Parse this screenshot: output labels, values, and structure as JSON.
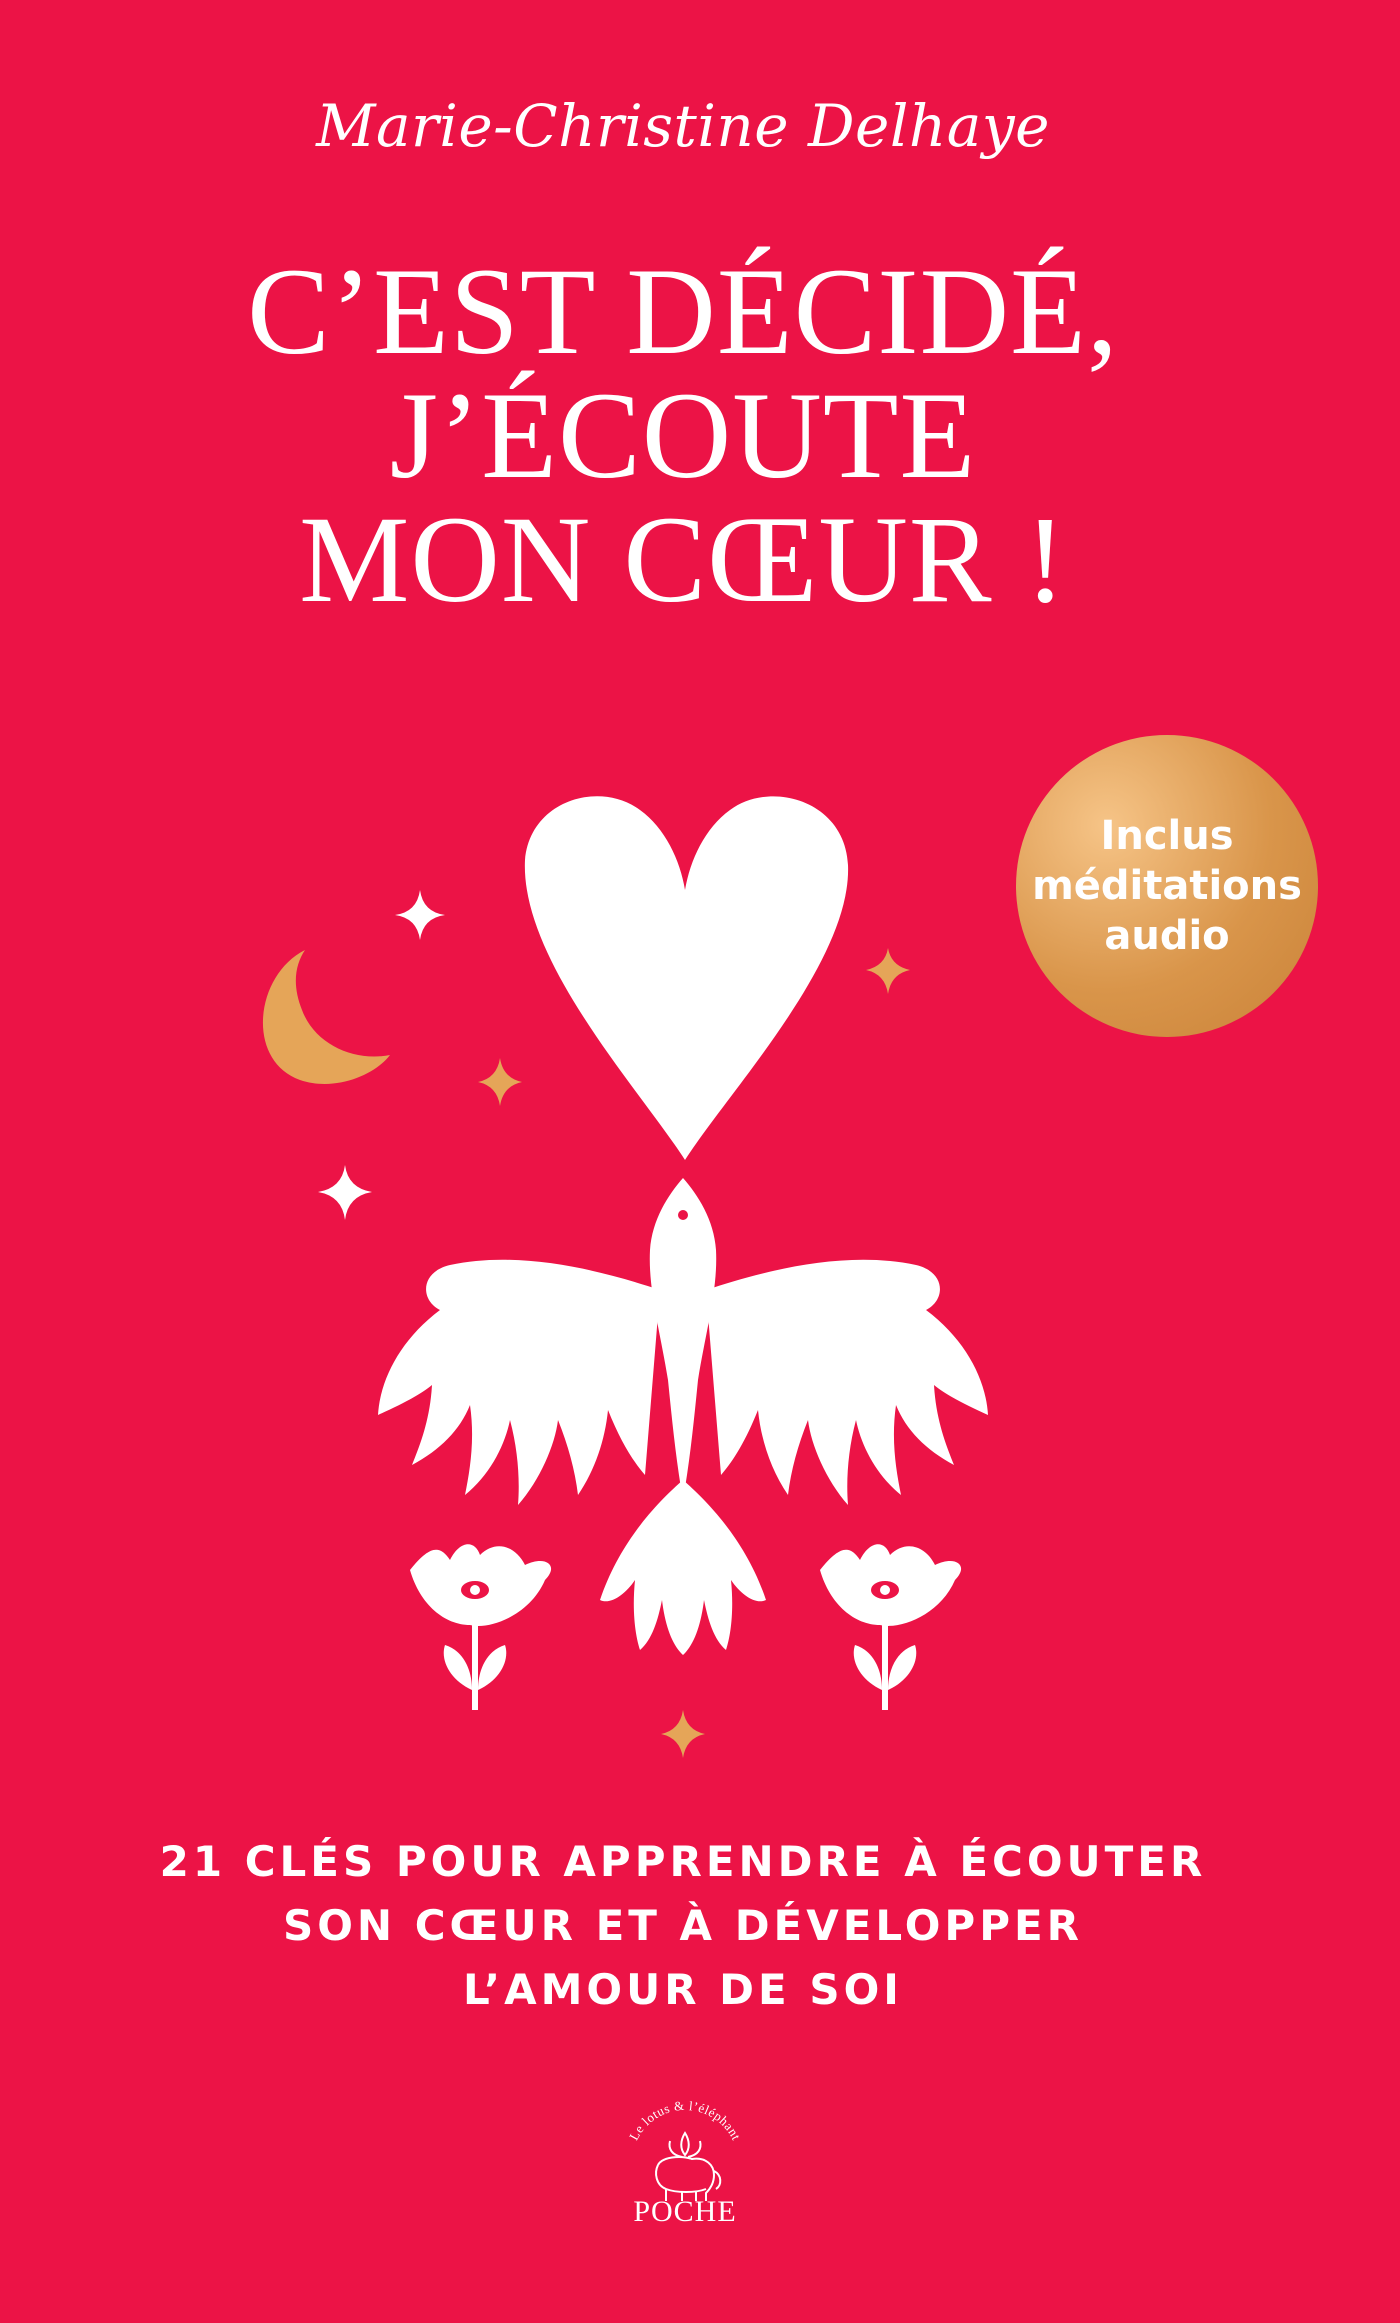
{
  "cover": {
    "author": "Marie-Christine Delhaye",
    "title_lines": [
      "C’EST DÉCIDÉ,",
      "J’ÉCOUTE",
      "MON CŒUR !"
    ],
    "badge_lines": [
      "Inclus",
      "méditations",
      "audio"
    ],
    "subtitle_lines": [
      "21 CLÉS POUR APPRENDRE À ÉCOUTER",
      "SON CŒUR ET À DÉVELOPPER",
      "L’AMOUR DE SOI"
    ],
    "publisher_arc_text": "Le lotus & l’éléphant",
    "publisher_label": "POCHE"
  },
  "colors": {
    "background": "#ec1346",
    "foreground": "#ffffff",
    "gold": "#e5a558"
  },
  "icons": [
    "heart-icon",
    "dove-icon",
    "moon-icon",
    "sparkle-icon",
    "eye-flower-icon",
    "lotus-elephant-logo"
  ]
}
